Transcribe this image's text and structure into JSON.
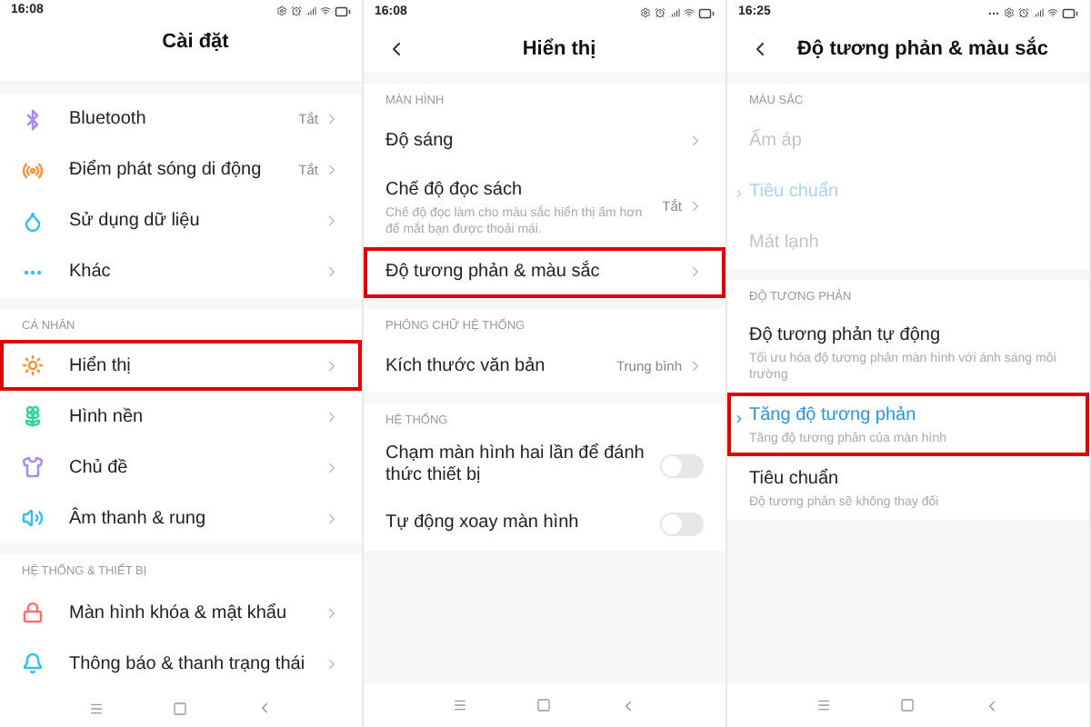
{
  "panels": [
    {
      "status_time": "16:08",
      "extra_dots": false,
      "title": "Cài đặt",
      "back": false,
      "top_cut": true,
      "sections": [
        {
          "items": [
            {
              "kind": "icon_nav",
              "label": "Bluetooth",
              "value": "Tắt",
              "color": "#a78bfa",
              "highlighted": false
            },
            {
              "kind": "icon_nav",
              "label": "Điểm phát sóng di động",
              "value": "Tắt",
              "color": "#fb923c",
              "highlighted": false
            },
            {
              "kind": "icon_nav",
              "label": "Sử dụng dữ liệu",
              "color": "#38bdf8",
              "highlighted": false
            },
            {
              "kind": "icon_nav",
              "label": "Khác",
              "color": "#38bdf8",
              "highlighted": false
            }
          ]
        },
        {
          "header": "CÁ NHÂN",
          "items": [
            {
              "kind": "icon_nav",
              "label": "Hiển thị",
              "color": "#fb923c",
              "highlighted": true
            },
            {
              "kind": "icon_nav",
              "label": "Hình nền",
              "color": "#34d399",
              "highlighted": false
            },
            {
              "kind": "icon_nav",
              "label": "Chủ đề",
              "color": "#a78bfa",
              "highlighted": false
            },
            {
              "kind": "icon_nav",
              "label": "Âm thanh & rung",
              "color": "#38bdf8",
              "highlighted": false
            }
          ]
        },
        {
          "header": "HỆ THỐNG & THIẾT BỊ",
          "items": [
            {
              "kind": "icon_nav",
              "label": "Màn hình khóa & mật khẩu",
              "color": "#f87171",
              "highlighted": false
            },
            {
              "kind": "icon_nav",
              "label": "Thông báo & thanh trạng thái",
              "color": "#38bdf8",
              "highlighted": false
            }
          ]
        }
      ]
    },
    {
      "status_time": "16:08",
      "extra_dots": false,
      "title": "Hiển thị",
      "back": true,
      "top_cut": false,
      "sections": [
        {
          "header": "MÀN HÌNH",
          "items": [
            {
              "kind": "nav",
              "label": "Độ sáng",
              "highlighted": false
            },
            {
              "kind": "nav",
              "label": "Chế độ đọc sách",
              "description": "Chế độ đọc làm cho màu sắc hiển thị ấm hơn để mắt bạn được thoải mái.",
              "value": "Tắt",
              "highlighted": false
            },
            {
              "kind": "nav",
              "label": "Độ tương phản & màu sắc",
              "highlighted": true
            }
          ]
        },
        {
          "header": "PHÔNG CHỮ HỆ THỐNG",
          "items": [
            {
              "kind": "nav",
              "label": "Kích thước văn bản",
              "value": "Trung bình",
              "highlighted": false
            }
          ]
        },
        {
          "header": "HỆ THỐNG",
          "items": [
            {
              "kind": "toggle",
              "label": "Chạm màn hình hai lần để đánh thức thiết bị",
              "on": false,
              "highlighted": false
            },
            {
              "kind": "toggle",
              "label": "Tự động xoay màn hình",
              "on": false,
              "highlighted": false
            }
          ]
        }
      ]
    },
    {
      "status_time": "16:25",
      "extra_dots": true,
      "title": "Độ tương phản & màu sắc",
      "back": true,
      "top_cut": false,
      "sections": [
        {
          "header": "MÀU SẮC",
          "items": [
            {
              "kind": "option",
              "label": "Ấm áp",
              "selected": false,
              "disabled": true,
              "highlighted": false
            },
            {
              "kind": "option",
              "label": "Tiêu chuẩn",
              "selected": true,
              "disabled": true,
              "highlighted": false
            },
            {
              "kind": "option",
              "label": "Mát lạnh",
              "selected": false,
              "disabled": true,
              "highlighted": false
            }
          ]
        },
        {
          "header": "ĐỘ TƯƠNG PHẢN",
          "items": [
            {
              "kind": "option",
              "label": "Độ tương phản tự động",
              "description": "Tối ưu hóa độ tương phản màn hình với ánh sáng môi trường",
              "selected": false,
              "disabled": false,
              "highlighted": false
            },
            {
              "kind": "option",
              "label": "Tăng độ tương phản",
              "description": "Tăng độ tương phản của màn hình",
              "selected": true,
              "disabled": false,
              "highlighted": true
            },
            {
              "kind": "option",
              "label": "Tiêu chuẩn",
              "description": "Độ tương phản sẽ không thay đổi",
              "selected": false,
              "disabled": false,
              "highlighted": false
            }
          ]
        }
      ]
    }
  ]
}
